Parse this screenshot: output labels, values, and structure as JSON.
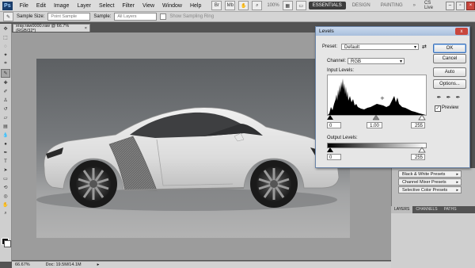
{
  "menubar": {
    "app_icon": "Ps",
    "items": [
      "File",
      "Edit",
      "Image",
      "Layer",
      "Select",
      "Filter",
      "View",
      "Window",
      "Help"
    ],
    "zoom": "100%",
    "workspaces": [
      "ESSENTIALS",
      "DESIGN",
      "PAINTING"
    ],
    "more": "»",
    "cs_live": "CS Live"
  },
  "optbar": {
    "sample_size_label": "Sample Size:",
    "sample_size_value": "Point Sample",
    "sample_label": "Sample:",
    "sample_value": "All Layers",
    "show_ring": "Show Sampling Ring"
  },
  "document": {
    "tab_title": "xray.raw0000.raw @ 66.7% (RGB/32*)",
    "tab_close": "×",
    "status_zoom": "66.67%",
    "status_doc": "Doc: 19.5M/14.1M"
  },
  "adjust_panel": {
    "items": [
      "Black & White Presets",
      "Channel Mixer Presets",
      "Selective Color Presets"
    ],
    "tabs": [
      "LAYERS",
      "CHANNELS",
      "PATHS"
    ]
  },
  "levels": {
    "title": "Levels",
    "preset_label": "Preset:",
    "preset_value": "Default",
    "channel_label": "Channel:",
    "channel_value": "RGB",
    "input_levels_label": "Input Levels:",
    "input_black": "0",
    "input_gamma": "1.00",
    "input_white": "255",
    "output_levels_label": "Output Levels:",
    "output_black": "0",
    "output_white": "255",
    "buttons": {
      "ok": "OK",
      "cancel": "Cancel",
      "auto": "Auto",
      "options": "Options..."
    },
    "preview_label": "Preview",
    "preview_checked": true,
    "close": "x"
  }
}
